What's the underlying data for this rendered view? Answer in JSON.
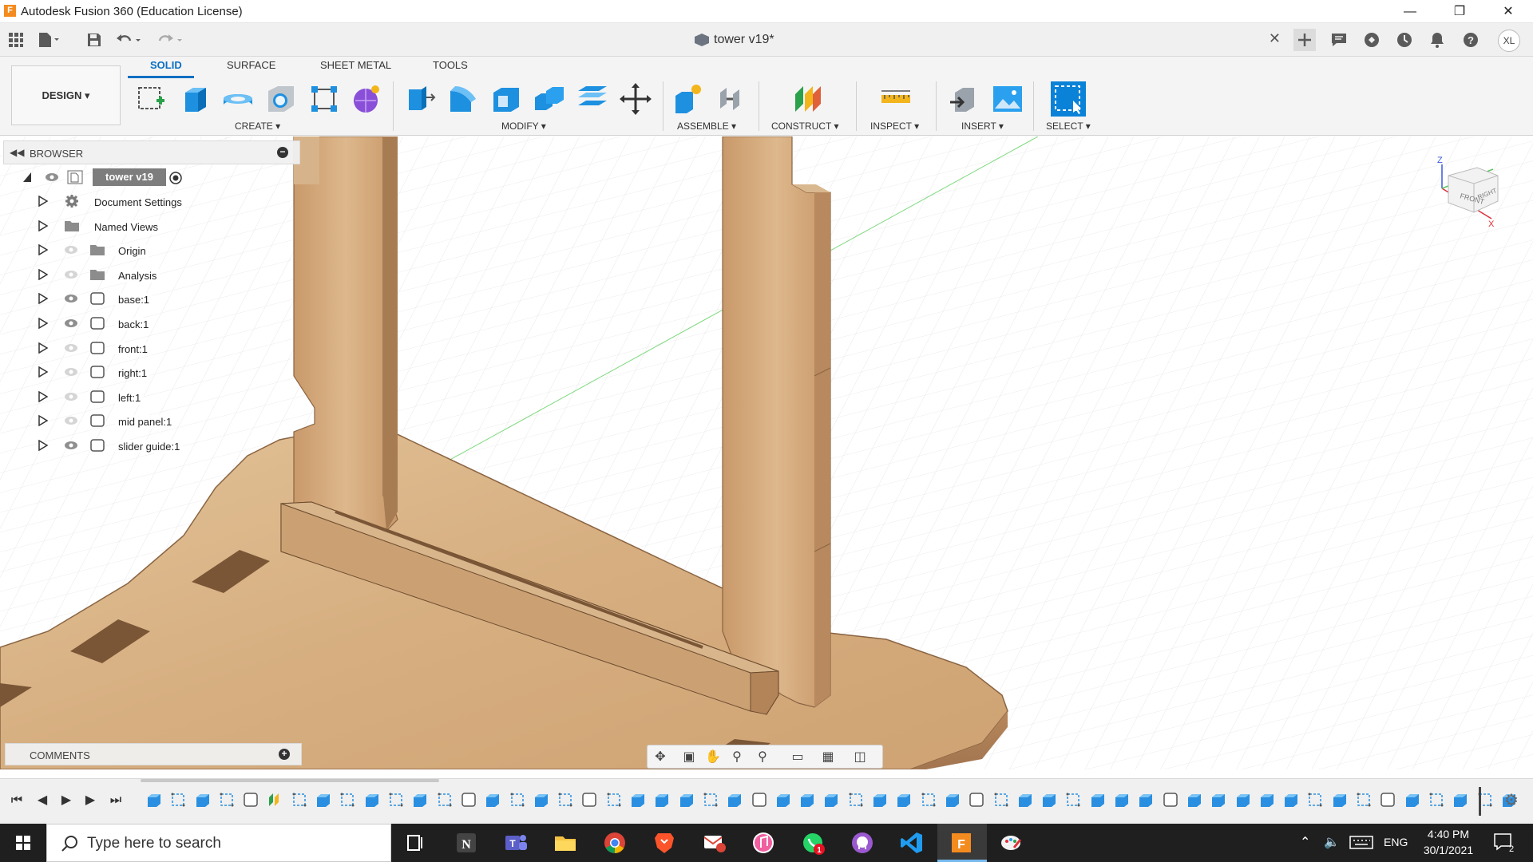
{
  "window": {
    "app_title": "Autodesk Fusion 360 (Education License)",
    "logo_letter": "F",
    "minimize": "—",
    "restore": "❐",
    "close": "✕"
  },
  "toolbar": {
    "doc_title": "tower v19*",
    "doc_close": "✕",
    "user_initials": "XL"
  },
  "ribbon": {
    "workspace": "DESIGN ▾",
    "tabs": [
      "SOLID",
      "SURFACE",
      "SHEET METAL",
      "TOOLS"
    ],
    "active_tab": "SOLID",
    "groups": [
      "CREATE ▾",
      "MODIFY ▾",
      "ASSEMBLE ▾",
      "CONSTRUCT ▾",
      "INSPECT ▾",
      "INSERT ▾",
      "SELECT ▾"
    ]
  },
  "browser": {
    "title": "BROWSER",
    "root": "tower v19",
    "items": [
      {
        "label": "Document Settings",
        "icon": "gear-icon",
        "eye": false
      },
      {
        "label": "Named Views",
        "icon": "folder-icon",
        "eye": false
      },
      {
        "label": "Origin",
        "icon": "folder-icon",
        "eye": true,
        "visible": false
      },
      {
        "label": "Analysis",
        "icon": "folder-icon",
        "eye": true,
        "visible": false
      },
      {
        "label": "base:1",
        "icon": "body-icon",
        "eye": true,
        "visible": true
      },
      {
        "label": "back:1",
        "icon": "body-icon",
        "eye": true,
        "visible": true
      },
      {
        "label": "front:1",
        "icon": "body-icon",
        "eye": true,
        "visible": false
      },
      {
        "label": "right:1",
        "icon": "body-icon",
        "eye": true,
        "visible": false
      },
      {
        "label": "left:1",
        "icon": "body-icon",
        "eye": true,
        "visible": false
      },
      {
        "label": "mid panel:1",
        "icon": "body-icon",
        "eye": true,
        "visible": false
      },
      {
        "label": "slider guide:1",
        "icon": "body-icon",
        "eye": true,
        "visible": true
      }
    ]
  },
  "comments": {
    "title": "COMMENTS"
  },
  "viewcube": {
    "front": "FRONT",
    "right": "RIGHT",
    "axis_z": "Z",
    "axis_x": "X"
  },
  "taskbar": {
    "search_placeholder": "Type here to search",
    "language": "ENG",
    "time": "4:40 PM",
    "date": "30/1/2021",
    "notification_count": "2",
    "whatsapp_badge": "1"
  },
  "colors": {
    "accent": "#0a6fc2",
    "wood": "#d7b48a",
    "taskbar": "#1f1f1f"
  }
}
